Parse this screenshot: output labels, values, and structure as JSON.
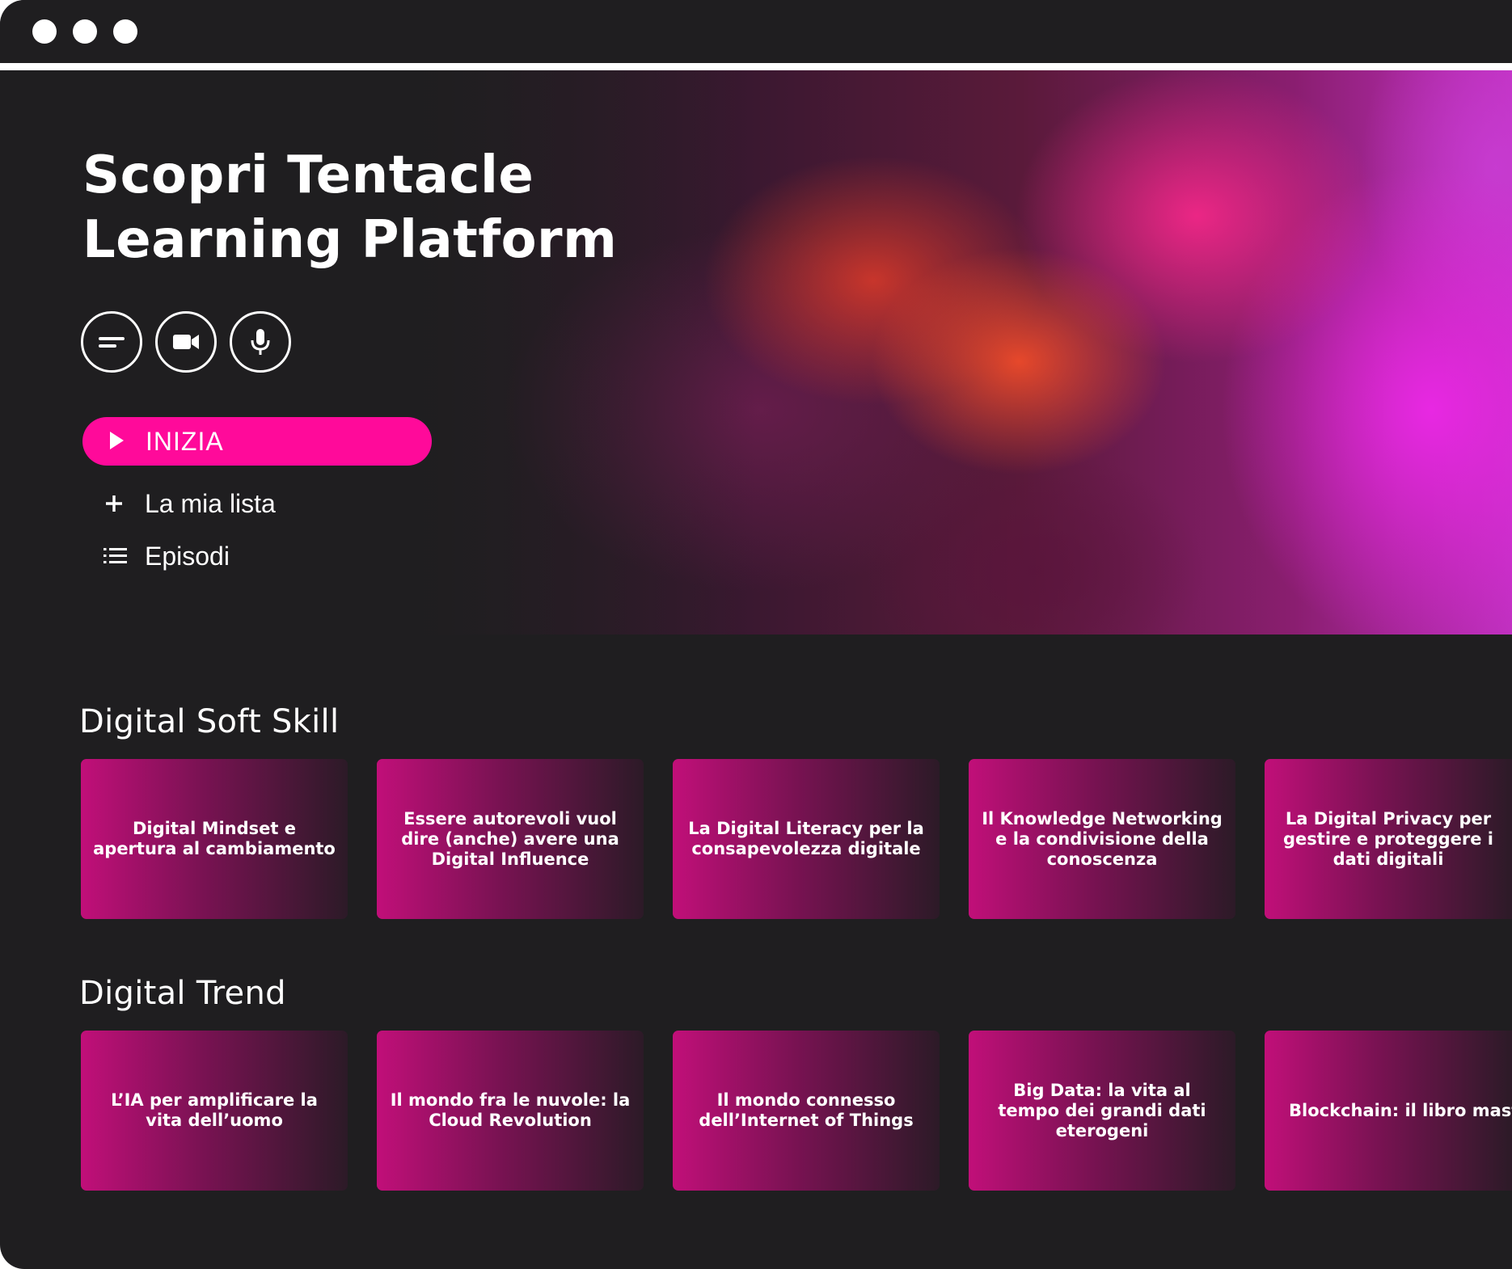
{
  "window": {
    "dots": [
      "dot",
      "dot",
      "dot"
    ]
  },
  "hero": {
    "title": "Scopri Tentacle Learning Platform",
    "format_buttons": [
      {
        "icon": "text-lines-icon"
      },
      {
        "icon": "video-camera-icon"
      },
      {
        "icon": "microphone-icon"
      }
    ],
    "start_label": "INIZIA",
    "my_list_label": "La mia lista",
    "episodes_label": "Episodi"
  },
  "sections": [
    {
      "title": "Digital Soft Skill",
      "cards": [
        "Digital Mindset e apertura al cambiamento",
        "Essere autorevoli vuol dire (anche) avere una Digital Influence",
        "La Digital Literacy per la consapevolezza digitale",
        "Il Knowledge Networking e la condivisione della conoscenza",
        "La Digital Privacy per gestire e proteggere i dati digitali"
      ]
    },
    {
      "title": "Digital Trend",
      "cards": [
        "L’IA per amplificare la vita dell’uomo",
        "Il mondo fra le nuvole: la Cloud Revolution",
        "Il mondo connesso dell’Internet of Things",
        "Big Data: la vita al tempo dei grandi dati eterogeni",
        "Blockchain: il libro mastro digitale"
      ]
    }
  ],
  "colors": {
    "accent": "#ff0a9a",
    "background": "#1f1e20",
    "card_start": "#c10f79"
  }
}
